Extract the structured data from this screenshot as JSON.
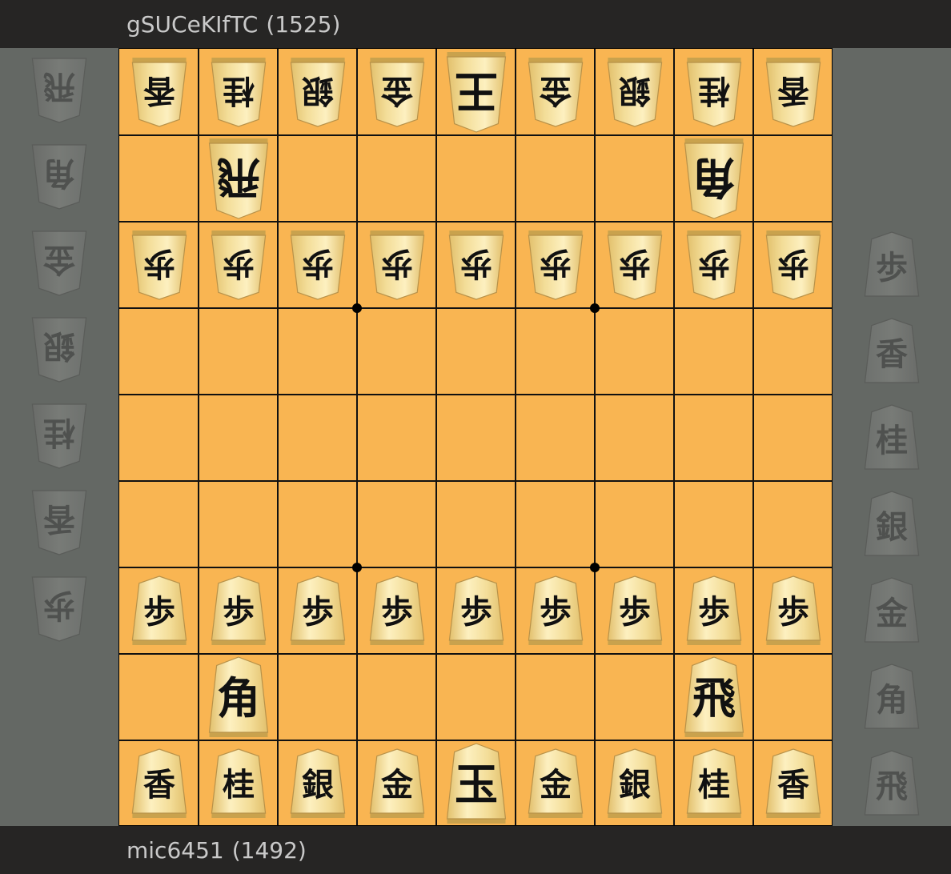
{
  "players": {
    "top": {
      "name": "gSUCeKIfTC",
      "rating": "(1525)"
    },
    "bottom": {
      "name": "mic6451",
      "rating": "(1492)"
    }
  },
  "board": {
    "ranks": [
      [
        "香",
        "桂",
        "銀",
        "金",
        "王",
        "金",
        "銀",
        "桂",
        "香"
      ],
      [
        "",
        "飛",
        "",
        "",
        "",
        "",
        "",
        "角",
        ""
      ],
      [
        "歩",
        "歩",
        "歩",
        "歩",
        "歩",
        "歩",
        "歩",
        "歩",
        "歩"
      ],
      [
        "",
        "",
        "",
        "",
        "",
        "",
        "",
        "",
        ""
      ],
      [
        "",
        "",
        "",
        "",
        "",
        "",
        "",
        "",
        ""
      ],
      [
        "",
        "",
        "",
        "",
        "",
        "",
        "",
        "",
        ""
      ],
      [
        "歩",
        "歩",
        "歩",
        "歩",
        "歩",
        "歩",
        "歩",
        "歩",
        "歩"
      ],
      [
        "",
        "角",
        "",
        "",
        "",
        "",
        "",
        "飛",
        ""
      ],
      [
        "香",
        "桂",
        "銀",
        "金",
        "玉",
        "金",
        "銀",
        "桂",
        "香"
      ]
    ],
    "owners": [
      [
        "gote",
        "gote",
        "gote",
        "gote",
        "gote",
        "gote",
        "gote",
        "gote",
        "gote"
      ],
      [
        "",
        "gote",
        "",
        "",
        "",
        "",
        "",
        "gote",
        ""
      ],
      [
        "gote",
        "gote",
        "gote",
        "gote",
        "gote",
        "gote",
        "gote",
        "gote",
        "gote"
      ],
      [
        "",
        "",
        "",
        "",
        "",
        "",
        "",
        "",
        ""
      ],
      [
        "",
        "",
        "",
        "",
        "",
        "",
        "",
        "",
        ""
      ],
      [
        "",
        "",
        "",
        "",
        "",
        "",
        "",
        "",
        ""
      ],
      [
        "sente",
        "sente",
        "sente",
        "sente",
        "sente",
        "sente",
        "sente",
        "sente",
        "sente"
      ],
      [
        "",
        "sente",
        "",
        "",
        "",
        "",
        "",
        "sente",
        ""
      ],
      [
        "sente",
        "sente",
        "sente",
        "sente",
        "sente",
        "sente",
        "sente",
        "sente",
        "sente"
      ]
    ]
  },
  "hands": {
    "gote": [
      "飛",
      "角",
      "金",
      "銀",
      "桂",
      "香",
      "歩"
    ],
    "sente": [
      "歩",
      "香",
      "桂",
      "銀",
      "金",
      "角",
      "飛"
    ]
  },
  "colors": {
    "board": "#f9b552",
    "piece_light": "#fdf0c0",
    "piece_dark": "#e2c06c",
    "ink": "#111111"
  }
}
